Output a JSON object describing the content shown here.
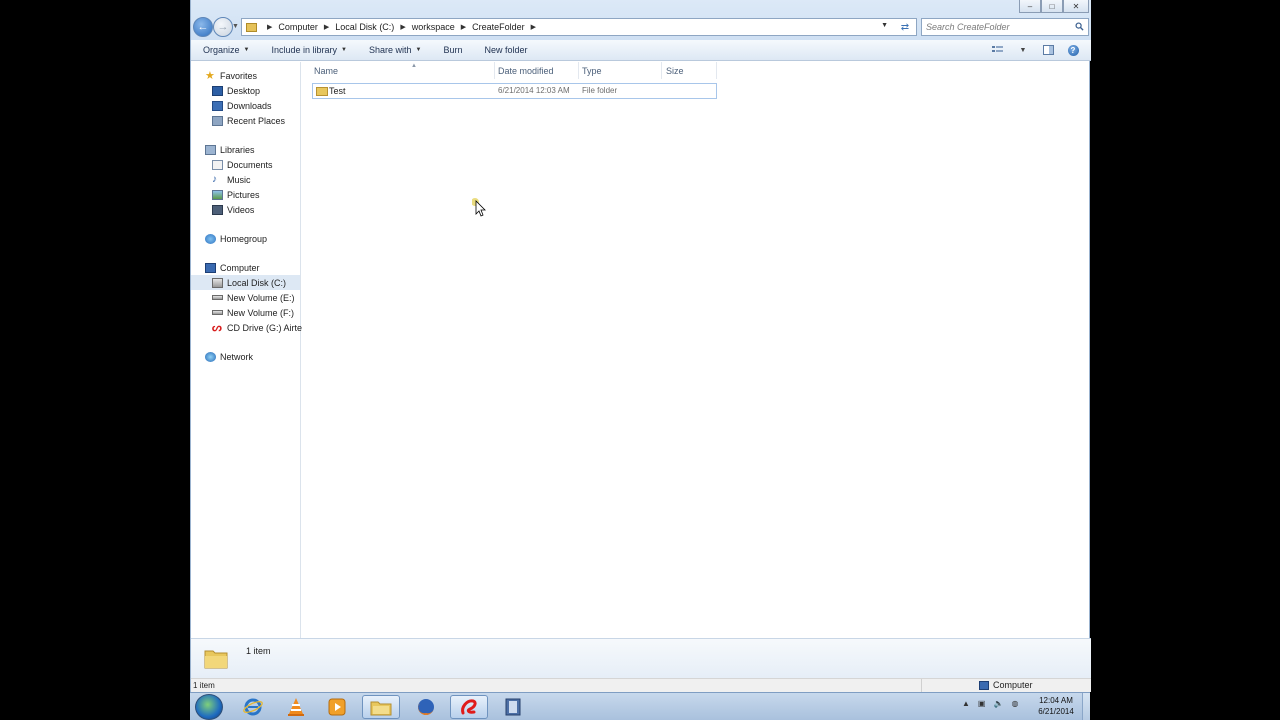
{
  "window": {
    "controls": {
      "minimize": "–",
      "maximize": "□",
      "close": "✕"
    }
  },
  "address": {
    "crumbs": [
      "Computer",
      "Local Disk (C:)",
      "workspace",
      "CreateFolder"
    ],
    "search_placeholder": "Search CreateFolder"
  },
  "toolbar": {
    "organize": "Organize",
    "include_in_library": "Include in library",
    "share_with": "Share with",
    "burn": "Burn",
    "new_folder": "New folder",
    "help": "?"
  },
  "navpane": {
    "favorites": {
      "label": "Favorites",
      "items": [
        "Desktop",
        "Downloads",
        "Recent Places"
      ]
    },
    "libraries": {
      "label": "Libraries",
      "items": [
        "Documents",
        "Music",
        "Pictures",
        "Videos"
      ]
    },
    "homegroup": "Homegroup",
    "computer": {
      "label": "Computer",
      "items": [
        "Local Disk (C:)",
        "New Volume (E:)",
        "New Volume (F:)",
        "CD Drive (G:) Airtel"
      ]
    },
    "network": "Network"
  },
  "columns": {
    "name": "Name",
    "date_modified": "Date modified",
    "type": "Type",
    "size": "Size"
  },
  "files": [
    {
      "name": "Test",
      "date_modified": "6/21/2014 12:03 AM",
      "type": "File folder",
      "size": ""
    }
  ],
  "details": {
    "count": "1 item"
  },
  "statusbar": {
    "count": "1 item",
    "location": "Computer"
  },
  "taskbar": {
    "apps": [
      "internet-explorer-icon",
      "vlc-icon",
      "media-player-icon",
      "explorer-icon",
      "firefox-icon",
      "airtel-icon",
      "video-app-icon"
    ],
    "clock_time": "12:04 AM",
    "clock_date": "6/21/2014"
  }
}
